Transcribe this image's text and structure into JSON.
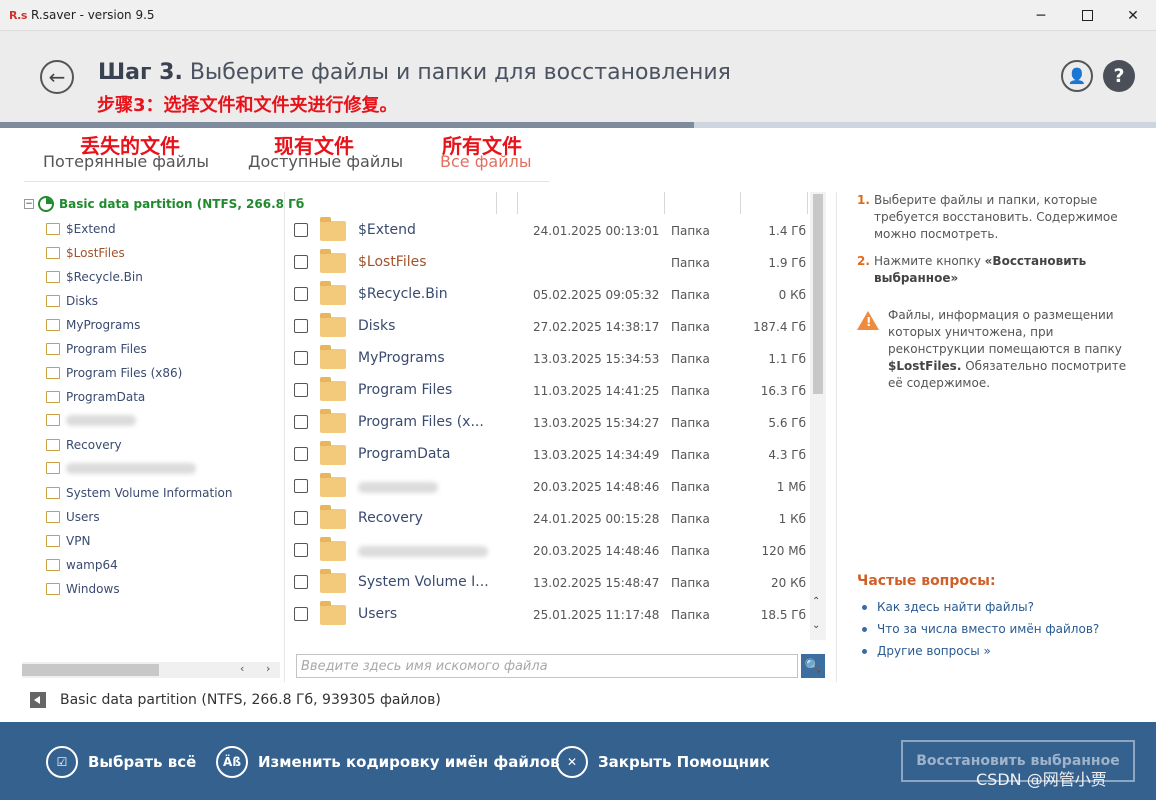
{
  "window": {
    "logo": "R.s",
    "title": "R.saver - version 9.5"
  },
  "header": {
    "step_label": "Шаг 3.",
    "title": "Выберите файлы и папки для восстановления",
    "annotation": "步骤3：选择文件和文件夹进行修复。"
  },
  "progress": {
    "fraction": 0.6
  },
  "tabs": [
    {
      "label": "Потерянные файлы",
      "annotation": "丢失的文件",
      "active": false
    },
    {
      "label": "Доступные файлы",
      "annotation": "现有文件",
      "active": false
    },
    {
      "label": "Все файлы",
      "annotation": "所有文件",
      "active": true
    }
  ],
  "tree": {
    "root": "Basic data partition (NTFS, 266.8 Гб",
    "items": [
      {
        "label": "$Extend",
        "lost": false,
        "blurred": false
      },
      {
        "label": "$LostFiles",
        "lost": true,
        "blurred": false
      },
      {
        "label": "$Recycle.Bin",
        "lost": false,
        "blurred": false
      },
      {
        "label": "Disks",
        "lost": false,
        "blurred": false
      },
      {
        "label": "MyPrograms",
        "lost": false,
        "blurred": false
      },
      {
        "label": "Program Files",
        "lost": false,
        "blurred": false
      },
      {
        "label": "Program Files (x86)",
        "lost": false,
        "blurred": false
      },
      {
        "label": "ProgramData",
        "lost": false,
        "blurred": false
      },
      {
        "label": "",
        "lost": false,
        "blurred": true
      },
      {
        "label": "Recovery",
        "lost": false,
        "blurred": false
      },
      {
        "label": "",
        "lost": false,
        "blurred": true
      },
      {
        "label": "System Volume Information",
        "lost": false,
        "blurred": false
      },
      {
        "label": "Users",
        "lost": false,
        "blurred": false
      },
      {
        "label": "VPN",
        "lost": false,
        "blurred": false
      },
      {
        "label": "wamp64",
        "lost": false,
        "blurred": false
      },
      {
        "label": "Windows",
        "lost": false,
        "blurred": false
      }
    ]
  },
  "files": {
    "rows": [
      {
        "name": "$Extend",
        "date": "24.01.2025 00:13:01",
        "type": "Папка",
        "size": "1.4 Гб",
        "lost": false,
        "blurred": false
      },
      {
        "name": "$LostFiles",
        "date": "",
        "type": "Папка",
        "size": "1.9 Гб",
        "lost": true,
        "blurred": false
      },
      {
        "name": "$Recycle.Bin",
        "date": "05.02.2025 09:05:32",
        "type": "Папка",
        "size": "0 Кб",
        "lost": false,
        "blurred": false
      },
      {
        "name": "Disks",
        "date": "27.02.2025 14:38:17",
        "type": "Папка",
        "size": "187.4 Гб",
        "lost": false,
        "blurred": false
      },
      {
        "name": "MyPrograms",
        "date": "13.03.2025 15:34:53",
        "type": "Папка",
        "size": "1.1 Гб",
        "lost": false,
        "blurred": false
      },
      {
        "name": "Program Files",
        "date": "11.03.2025 14:41:25",
        "type": "Папка",
        "size": "16.3 Гб",
        "lost": false,
        "blurred": false
      },
      {
        "name": "Program Files (x...",
        "date": "13.03.2025 15:34:27",
        "type": "Папка",
        "size": "5.6 Гб",
        "lost": false,
        "blurred": false
      },
      {
        "name": "ProgramData",
        "date": "13.03.2025 14:34:49",
        "type": "Папка",
        "size": "4.3 Гб",
        "lost": false,
        "blurred": false
      },
      {
        "name": "",
        "date": "20.03.2025 14:48:46",
        "type": "Папка",
        "size": "1 Мб",
        "lost": false,
        "blurred": true
      },
      {
        "name": "Recovery",
        "date": "24.01.2025 00:15:28",
        "type": "Папка",
        "size": "1 Кб",
        "lost": false,
        "blurred": false
      },
      {
        "name": "",
        "date": "20.03.2025 14:48:46",
        "type": "Папка",
        "size": "120 Мб",
        "lost": false,
        "blurred": true
      },
      {
        "name": "System Volume I...",
        "date": "13.02.2025 15:48:47",
        "type": "Папка",
        "size": "20 Кб",
        "lost": false,
        "blurred": false
      },
      {
        "name": "Users",
        "date": "25.01.2025 11:17:48",
        "type": "Папка",
        "size": "18.5 Гб",
        "lost": false,
        "blurred": false
      }
    ]
  },
  "search": {
    "placeholder": "Введите здесь имя искомого файла"
  },
  "help": {
    "step1_num": "1.",
    "step1_text": "Выберите файлы и папки, которые требуется восстановить. Содержимое можно посмотреть.",
    "step2_num": "2.",
    "step2_text_a": "Нажмите кнопку ",
    "step2_text_b": "«Восстановить выбранное»",
    "warn_text_a": "Файлы, информация о размещении которых уничтожена, при реконструкции помещаются в папку ",
    "warn_text_b": "$LostFiles.",
    "warn_text_c": " Обязательно посмотрите её содержимое.",
    "faq_title": "Частые вопросы:",
    "faq_links": [
      "Как здесь найти файлы?",
      "Что за числа вместо имён файлов?",
      "Другие вопросы »"
    ]
  },
  "status": {
    "text": "Basic data partition (NTFS, 266.8 Гб, 939305 файлов)"
  },
  "footer": {
    "select_all": "Выбрать всё",
    "encoding_icon": "Äß",
    "encoding": "Изменить кодировку имён файлов",
    "close_wizard": "Закрыть Помощник",
    "restore": "Восстановить выбранное"
  },
  "watermark": "CSDN @网管小贾",
  "colors": {
    "accent_orange": "#e0691c",
    "lost_brown": "#a0522d",
    "footer_blue": "#35618f",
    "root_green": "#1f8a2e",
    "annotation_red": "#e8131a"
  },
  "icons": {
    "back": "arrow-left-icon",
    "user": "user-icon",
    "help": "question-icon",
    "search": "magnifier-icon",
    "warning": "warning-triangle-icon",
    "select_all": "checklist-icon",
    "encoding": "encoding-icon",
    "close": "close-x-icon"
  }
}
